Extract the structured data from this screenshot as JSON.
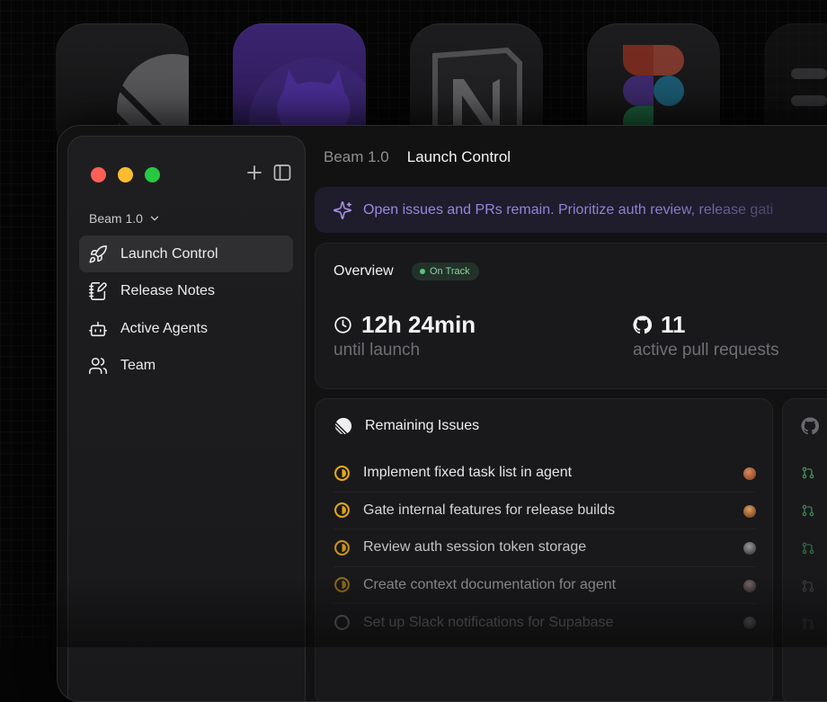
{
  "sidebar": {
    "workspace": "Beam 1.0",
    "items": [
      {
        "label": "Launch Control",
        "icon": "rocket-icon",
        "active": true
      },
      {
        "label": "Release Notes",
        "icon": "notebook-pen-icon",
        "active": false
      },
      {
        "label": "Active Agents",
        "icon": "bot-icon",
        "active": false
      },
      {
        "label": "Team",
        "icon": "users-icon",
        "active": false
      }
    ]
  },
  "breadcrumb": {
    "parent": "Beam 1.0",
    "current": "Launch Control"
  },
  "banner": {
    "text": "Open issues and PRs remain. Prioritize auth review, release gati"
  },
  "overview": {
    "title": "Overview",
    "status": "On Track",
    "stats": [
      {
        "value": "12h 24min",
        "label": "until launch",
        "icon": "clock-icon"
      },
      {
        "value": "11",
        "label": "active pull requests",
        "icon": "github-icon"
      }
    ]
  },
  "issues": {
    "title": "Remaining Issues",
    "items": [
      {
        "title": "Implement fixed task list in agent",
        "status": "in-progress"
      },
      {
        "title": "Gate internal features for release builds",
        "status": "in-progress"
      },
      {
        "title": "Review auth session token storage",
        "status": "in-progress"
      },
      {
        "title": "Create context documentation for agent",
        "status": "in-progress"
      },
      {
        "title": "Set up Slack notifications for Supabase",
        "status": "todo"
      }
    ]
  },
  "colors": {
    "in_progress": "#e6a817",
    "todo": "#6a6a6e",
    "accent_purple": "#a894e6",
    "on_track": "#5fc27a"
  }
}
